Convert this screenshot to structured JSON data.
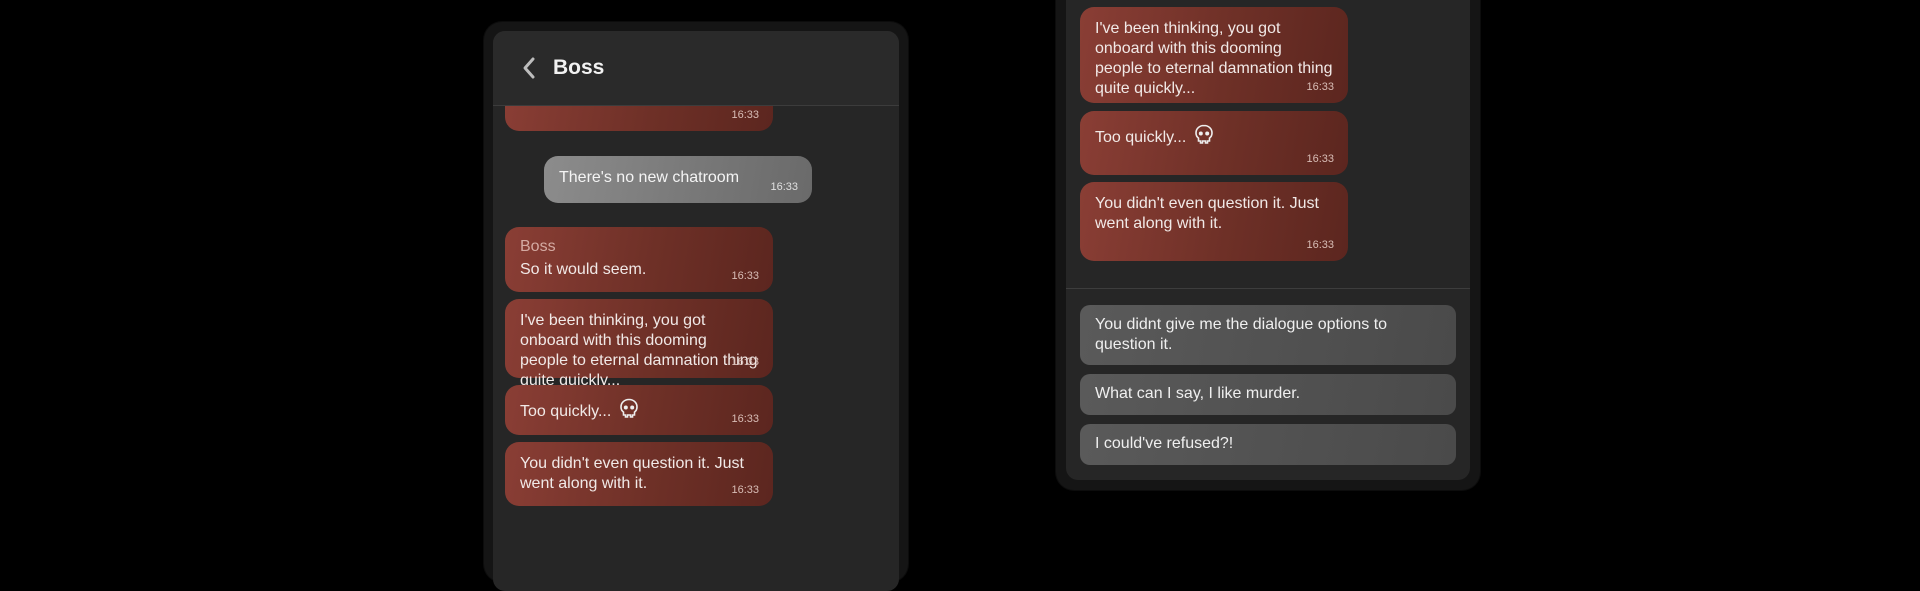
{
  "chat": {
    "title": "Boss",
    "messages": {
      "m0_time": "16:33",
      "m1_text": "There's no new chatroom",
      "m1_time": "16:33",
      "m2_sender": "Boss",
      "m2_text": "So it would seem.",
      "m2_time": "16:33",
      "m3_text": "I've been thinking, you got onboard with this dooming people to eternal damnation thing quite quickly...",
      "m3_time": "16:33",
      "m4_text": "Too quickly...",
      "m4_time": "16:33",
      "m5_text": "You didn't even question it. Just went along with it.",
      "m5_time": "16:33"
    }
  },
  "options": {
    "o1": "You didnt give me the dialogue options to question it.",
    "o2": "What can I say, I like murder.",
    "o3": "I could've refused?!"
  },
  "icons": {
    "back": "chevron-left-icon",
    "skull": "skull-icon"
  },
  "colors": {
    "npc_bubble": "#7a352d",
    "player_bubble": "#808080",
    "option": "#525252",
    "screen": "#262626"
  }
}
